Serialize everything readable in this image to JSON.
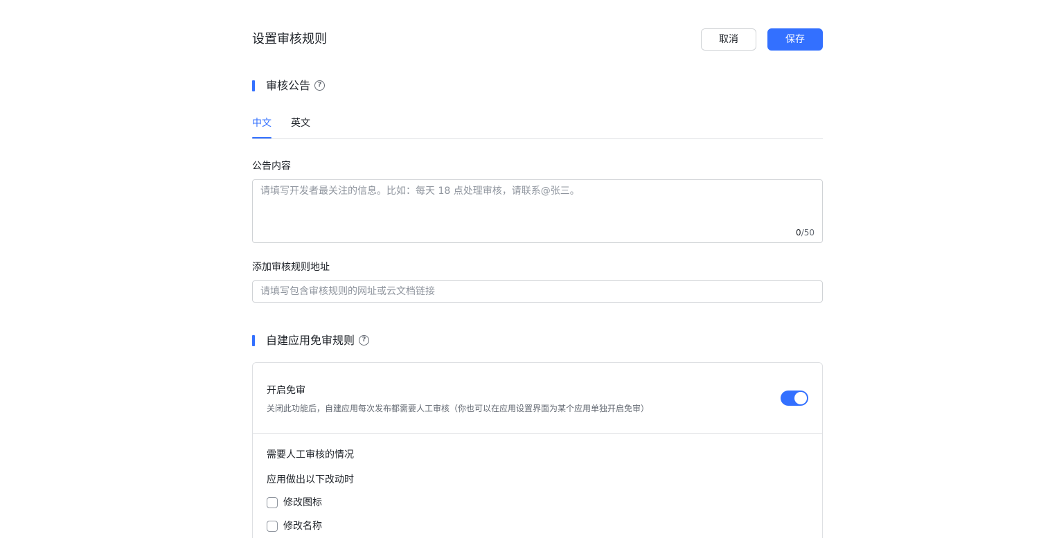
{
  "header": {
    "title": "设置审核规则",
    "cancel_label": "取消",
    "save_label": "保存"
  },
  "announcement": {
    "section_title": "审核公告",
    "help_icon": "question-circle-icon",
    "tabs": [
      {
        "label": "中文",
        "active": true
      },
      {
        "label": "英文",
        "active": false
      }
    ],
    "content_label": "公告内容",
    "content_value": "",
    "content_placeholder": "请填写开发者最关注的信息。比如：每天 18 点处理审核，请联系@张三。",
    "counter_current": "0",
    "counter_max": "/50",
    "url_label": "添加审核规则地址",
    "url_value": "",
    "url_placeholder": "请填写包含审核规则的网址或云文档链接"
  },
  "exemption": {
    "section_title": "自建应用免审规则",
    "help_icon": "question-circle-icon",
    "toggle_title": "开启免审",
    "toggle_desc": "关闭此功能后，自建应用每次发布都需要人工审核（你也可以在应用设置界面为某个应用单独开启免审）",
    "toggle_on": true,
    "manual_title": "需要人工审核的情况",
    "changes_title": "应用做出以下改动时",
    "options": [
      {
        "label": "修改图标",
        "checked": false
      },
      {
        "label": "修改名称",
        "checked": false
      }
    ]
  },
  "colors": {
    "primary": "#3370ff",
    "text": "#1f2329",
    "secondary_text": "#646a73",
    "placeholder": "#8f959e",
    "border": "#d0d3d6"
  }
}
